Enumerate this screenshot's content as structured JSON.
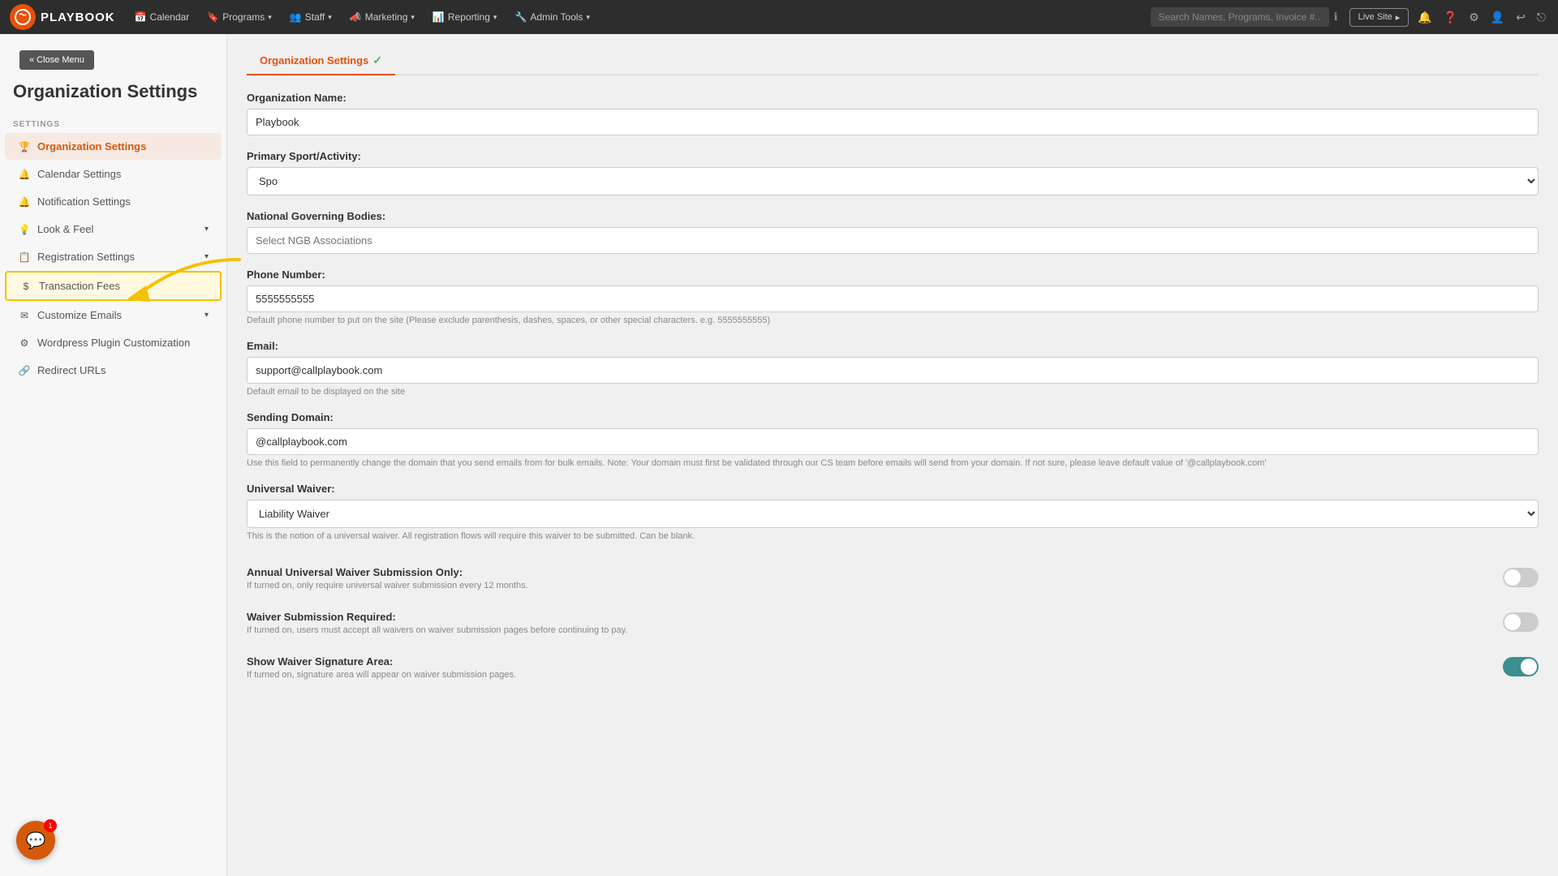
{
  "topnav": {
    "logo_initials": "PB",
    "logo_name": "PLAYBOOK",
    "nav_items": [
      {
        "label": "Calendar",
        "has_arrow": false
      },
      {
        "label": "Programs",
        "has_arrow": true
      },
      {
        "label": "Staff",
        "has_arrow": true
      },
      {
        "label": "Marketing",
        "has_arrow": true
      },
      {
        "label": "Reporting",
        "has_arrow": true
      },
      {
        "label": "Admin Tools",
        "has_arrow": true
      }
    ],
    "search_placeholder": "Search Names, Programs, Invoice #...",
    "live_site_btn": "Live Site",
    "help_icon": "?",
    "settings_icon": "⚙",
    "user_icon": "👤",
    "back_icon": "←",
    "exit_icon": "⎋"
  },
  "sidebar": {
    "close_menu_label": "« Close Menu",
    "page_title": "Organization Settings",
    "settings_section_label": "SETTINGS",
    "items": [
      {
        "label": "Organization Settings",
        "icon": "🏆",
        "active": true,
        "has_chevron": false
      },
      {
        "label": "Calendar Settings",
        "icon": "🔔",
        "active": false,
        "has_chevron": false
      },
      {
        "label": "Notification Settings",
        "icon": "🔔",
        "active": false,
        "has_chevron": false
      },
      {
        "label": "Look & Feel",
        "icon": "💡",
        "active": false,
        "has_chevron": true
      },
      {
        "label": "Registration Settings",
        "icon": "📋",
        "active": false,
        "has_chevron": true
      },
      {
        "label": "Transaction Fees",
        "icon": "$",
        "active": false,
        "has_chevron": false,
        "highlighted": true
      },
      {
        "label": "Customize Emails",
        "icon": "✉",
        "active": false,
        "has_chevron": true
      },
      {
        "label": "Wordpress Plugin Customization",
        "icon": "⚙",
        "active": false,
        "has_chevron": false
      },
      {
        "label": "Redirect URLs",
        "icon": "🔗",
        "active": false,
        "has_chevron": false
      }
    ]
  },
  "content": {
    "tab_label": "Organization Settings",
    "tab_check": "✓",
    "form": {
      "org_name_label": "Organization Name:",
      "org_name_value": "Playbook",
      "primary_sport_label": "Primary Sport/Activity:",
      "primary_sport_value": "Spo",
      "ngb_label": "National Governing Bodies:",
      "ngb_placeholder": "Select NGB Associations",
      "phone_label": "Phone Number:",
      "phone_value": "5555555555",
      "phone_hint": "Default phone number to put on the site (Please exclude parenthesis, dashes, spaces, or other special characters. e.g. 5555555555)",
      "email_label": "Email:",
      "email_value": "support@callplaybook.com",
      "email_hint": "Default email to be displayed on the site",
      "sending_domain_label": "Sending Domain:",
      "sending_domain_value": "@callplaybook.com",
      "sending_domain_hint": "Use this field to permanently change the domain that you send emails from for bulk emails. Note: Your domain must first be validated through our CS team before emails will send from your domain. If not sure, please leave default value of '@callplaybook.com'",
      "universal_waiver_label": "Universal Waiver:",
      "universal_waiver_value": "Liability Waiver",
      "universal_waiver_hint": "This is the notion of a universal waiver. All registration flows will require this waiver to be submitted. Can be blank.",
      "annual_waiver_title": "Annual Universal Waiver Submission Only:",
      "annual_waiver_desc": "If turned on, only require universal waiver submission every 12 months.",
      "annual_waiver_state": "off",
      "waiver_required_title": "Waiver Submission Required:",
      "waiver_required_desc": "If turned on, users must accept all waivers on waiver submission pages before continuing to pay.",
      "waiver_required_state": "off",
      "show_waiver_title": "Show Waiver Signature Area:",
      "show_waiver_desc": "If turned on, signature area will appear on waiver submission pages.",
      "show_waiver_state": "on"
    }
  },
  "chat": {
    "icon": "💬",
    "badge_count": "1"
  }
}
